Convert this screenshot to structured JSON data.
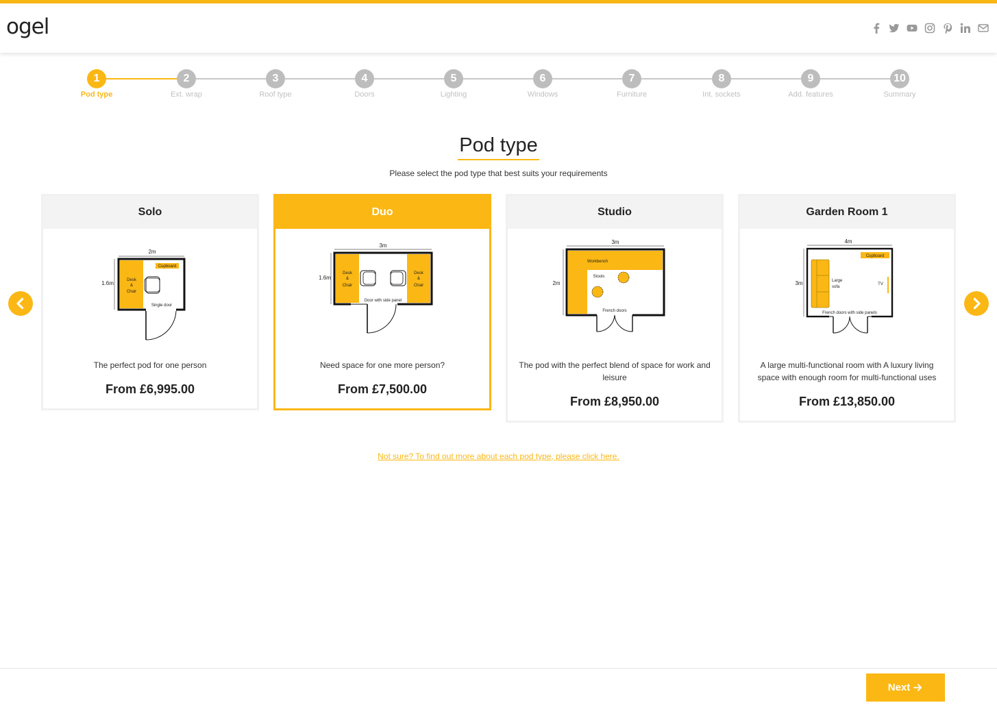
{
  "brand": {
    "logo_text": "ogel",
    "accent": "#fbb714"
  },
  "socials": [
    "facebook-icon",
    "twitter-icon",
    "youtube-icon",
    "instagram-icon",
    "pinterest-icon",
    "linkedin-icon",
    "email-icon"
  ],
  "steps": [
    {
      "num": "1",
      "label": "Pod type",
      "active": true
    },
    {
      "num": "2",
      "label": "Ext. wrap"
    },
    {
      "num": "3",
      "label": "Roof type"
    },
    {
      "num": "4",
      "label": "Doors"
    },
    {
      "num": "5",
      "label": "Lighting"
    },
    {
      "num": "6",
      "label": "Windows"
    },
    {
      "num": "7",
      "label": "Furniture"
    },
    {
      "num": "8",
      "label": "Int. sockets"
    },
    {
      "num": "9",
      "label": "Add. features"
    },
    {
      "num": "10",
      "label": "Summary"
    }
  ],
  "page": {
    "title": "Pod type",
    "subtitle": "Please select the pod type that best suits your requirements",
    "info_link": "Not sure? To find out more about each pod type, please click here."
  },
  "cards": [
    {
      "name": "Solo",
      "selected": false,
      "description": "The perfect pod for one person",
      "price": "From £6,995.00",
      "plan": {
        "width": "2m",
        "depth": "1.6m",
        "labels": [
          "Cupboard",
          "Desk",
          "&",
          "Chair",
          "Single door"
        ]
      }
    },
    {
      "name": "Duo",
      "selected": true,
      "description": "Need space for one more person?",
      "price": "From £7,500.00",
      "plan": {
        "width": "3m",
        "depth": "1.6m",
        "labels": [
          "Desk",
          "&",
          "Chair",
          "Desk",
          "&",
          "Chair",
          "Door with side panel"
        ]
      }
    },
    {
      "name": "Studio",
      "selected": false,
      "description": "The pod with the perfect blend of space for work and leisure",
      "price": "From £8,950.00",
      "plan": {
        "width": "3m",
        "depth": "2m",
        "labels": [
          "Workbench",
          "Stools",
          "French doors"
        ]
      }
    },
    {
      "name": "Garden Room 1",
      "selected": false,
      "description": "A large multi-functional room with A luxury living space with enough room for multi-functional uses",
      "price": "From £13,850.00",
      "plan": {
        "width": "4m",
        "depth": "3m",
        "labels": [
          "Cupboard",
          "Large",
          "sofa",
          "TV",
          "French doors with side panels"
        ]
      }
    }
  ],
  "footer": {
    "next_label": "Next"
  }
}
